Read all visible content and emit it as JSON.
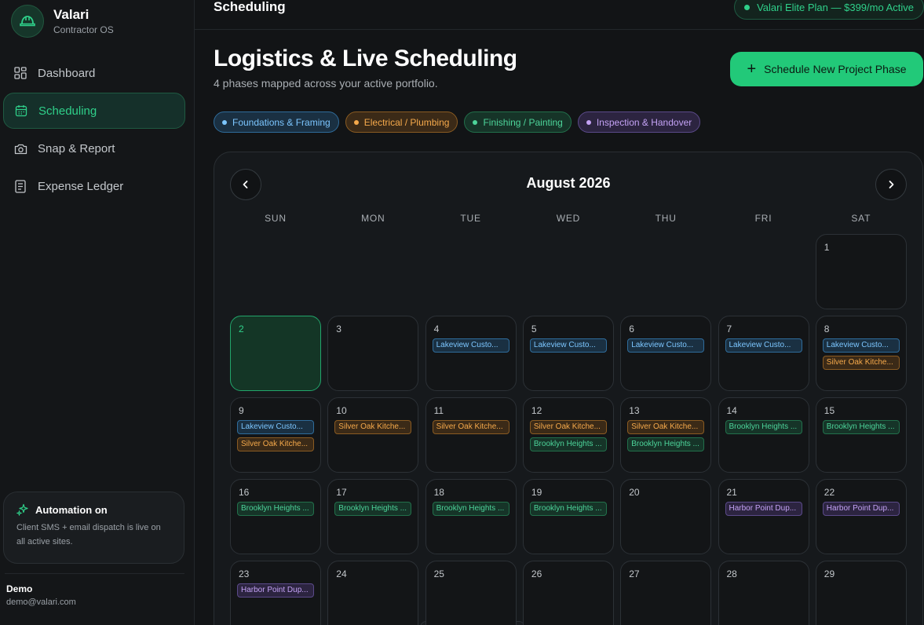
{
  "brand": {
    "name": "Valari",
    "subtitle": "Contractor OS",
    "logo_icon": "hard-hat-icon"
  },
  "nav": [
    {
      "label": "Dashboard",
      "icon": "dashboard-icon",
      "active": false
    },
    {
      "label": "Scheduling",
      "icon": "calendar-icon",
      "active": true
    },
    {
      "label": "Snap & Report",
      "icon": "camera-icon",
      "active": false
    },
    {
      "label": "Expense Ledger",
      "icon": "ledger-icon",
      "active": false
    }
  ],
  "automation": {
    "title": "Automation on",
    "description": "Client SMS + email dispatch is live on all active sites."
  },
  "user": {
    "name": "Demo",
    "email": "demo@valari.com"
  },
  "topbar": {
    "title": "Scheduling",
    "plan": "Valari Elite Plan — $399/mo Active"
  },
  "page": {
    "title": "Logistics & Live Scheduling",
    "subtitle": "4 phases mapped across your active portfolio.",
    "primary_action": "Schedule New Project Phase"
  },
  "legend": [
    {
      "label": "Foundations & Framing",
      "color": "blue"
    },
    {
      "label": "Electrical / Plumbing",
      "color": "orange"
    },
    {
      "label": "Finishing / Painting",
      "color": "green"
    },
    {
      "label": "Inspection & Handover",
      "color": "purple"
    }
  ],
  "colors": {
    "accent": "#22c979",
    "blue": "#7cc6ff",
    "orange": "#f5a94b",
    "green": "#4dd49a",
    "purple": "#c4a2f5"
  },
  "calendar": {
    "month": "August 2026",
    "weekdays": [
      "SUN",
      "MON",
      "TUE",
      "WED",
      "THU",
      "FRI",
      "SAT"
    ],
    "today": "2",
    "weeks": [
      [
        null,
        null,
        null,
        null,
        null,
        null,
        {
          "day": "1",
          "events": []
        }
      ],
      [
        {
          "day": "2",
          "events": []
        },
        {
          "day": "3",
          "events": []
        },
        {
          "day": "4",
          "events": [
            {
              "label": "Lakeview Custo...",
              "color": "blue"
            }
          ]
        },
        {
          "day": "5",
          "events": [
            {
              "label": "Lakeview Custo...",
              "color": "blue"
            }
          ]
        },
        {
          "day": "6",
          "events": [
            {
              "label": "Lakeview Custo...",
              "color": "blue"
            }
          ]
        },
        {
          "day": "7",
          "events": [
            {
              "label": "Lakeview Custo...",
              "color": "blue"
            }
          ]
        },
        {
          "day": "8",
          "events": [
            {
              "label": "Lakeview Custo...",
              "color": "blue"
            },
            {
              "label": "Silver Oak Kitche...",
              "color": "orange"
            }
          ]
        }
      ],
      [
        {
          "day": "9",
          "events": [
            {
              "label": "Lakeview Custo...",
              "color": "blue"
            },
            {
              "label": "Silver Oak Kitche...",
              "color": "orange"
            }
          ]
        },
        {
          "day": "10",
          "events": [
            {
              "label": "Silver Oak Kitche...",
              "color": "orange"
            }
          ]
        },
        {
          "day": "11",
          "events": [
            {
              "label": "Silver Oak Kitche...",
              "color": "orange"
            }
          ]
        },
        {
          "day": "12",
          "events": [
            {
              "label": "Silver Oak Kitche...",
              "color": "orange"
            },
            {
              "label": "Brooklyn Heights ...",
              "color": "green"
            }
          ]
        },
        {
          "day": "13",
          "events": [
            {
              "label": "Silver Oak Kitche...",
              "color": "orange"
            },
            {
              "label": "Brooklyn Heights ...",
              "color": "green"
            }
          ]
        },
        {
          "day": "14",
          "events": [
            {
              "label": "Brooklyn Heights ...",
              "color": "green"
            }
          ]
        },
        {
          "day": "15",
          "events": [
            {
              "label": "Brooklyn Heights ...",
              "color": "green"
            }
          ]
        }
      ],
      [
        {
          "day": "16",
          "events": [
            {
              "label": "Brooklyn Heights ...",
              "color": "green"
            }
          ]
        },
        {
          "day": "17",
          "events": [
            {
              "label": "Brooklyn Heights ...",
              "color": "green"
            }
          ]
        },
        {
          "day": "18",
          "events": [
            {
              "label": "Brooklyn Heights ...",
              "color": "green"
            }
          ]
        },
        {
          "day": "19",
          "events": [
            {
              "label": "Brooklyn Heights ...",
              "color": "green"
            }
          ]
        },
        {
          "day": "20",
          "events": []
        },
        {
          "day": "21",
          "events": [
            {
              "label": "Harbor Point Dup...",
              "color": "purple"
            }
          ]
        },
        {
          "day": "22",
          "events": [
            {
              "label": "Harbor Point Dup...",
              "color": "purple"
            }
          ]
        }
      ],
      [
        {
          "day": "23",
          "events": [
            {
              "label": "Harbor Point Dup...",
              "color": "purple"
            }
          ]
        },
        {
          "day": "24",
          "events": []
        },
        {
          "day": "25",
          "events": []
        },
        {
          "day": "26",
          "events": []
        },
        {
          "day": "27",
          "events": []
        },
        {
          "day": "28",
          "events": []
        },
        {
          "day": "29",
          "events": []
        }
      ]
    ]
  }
}
